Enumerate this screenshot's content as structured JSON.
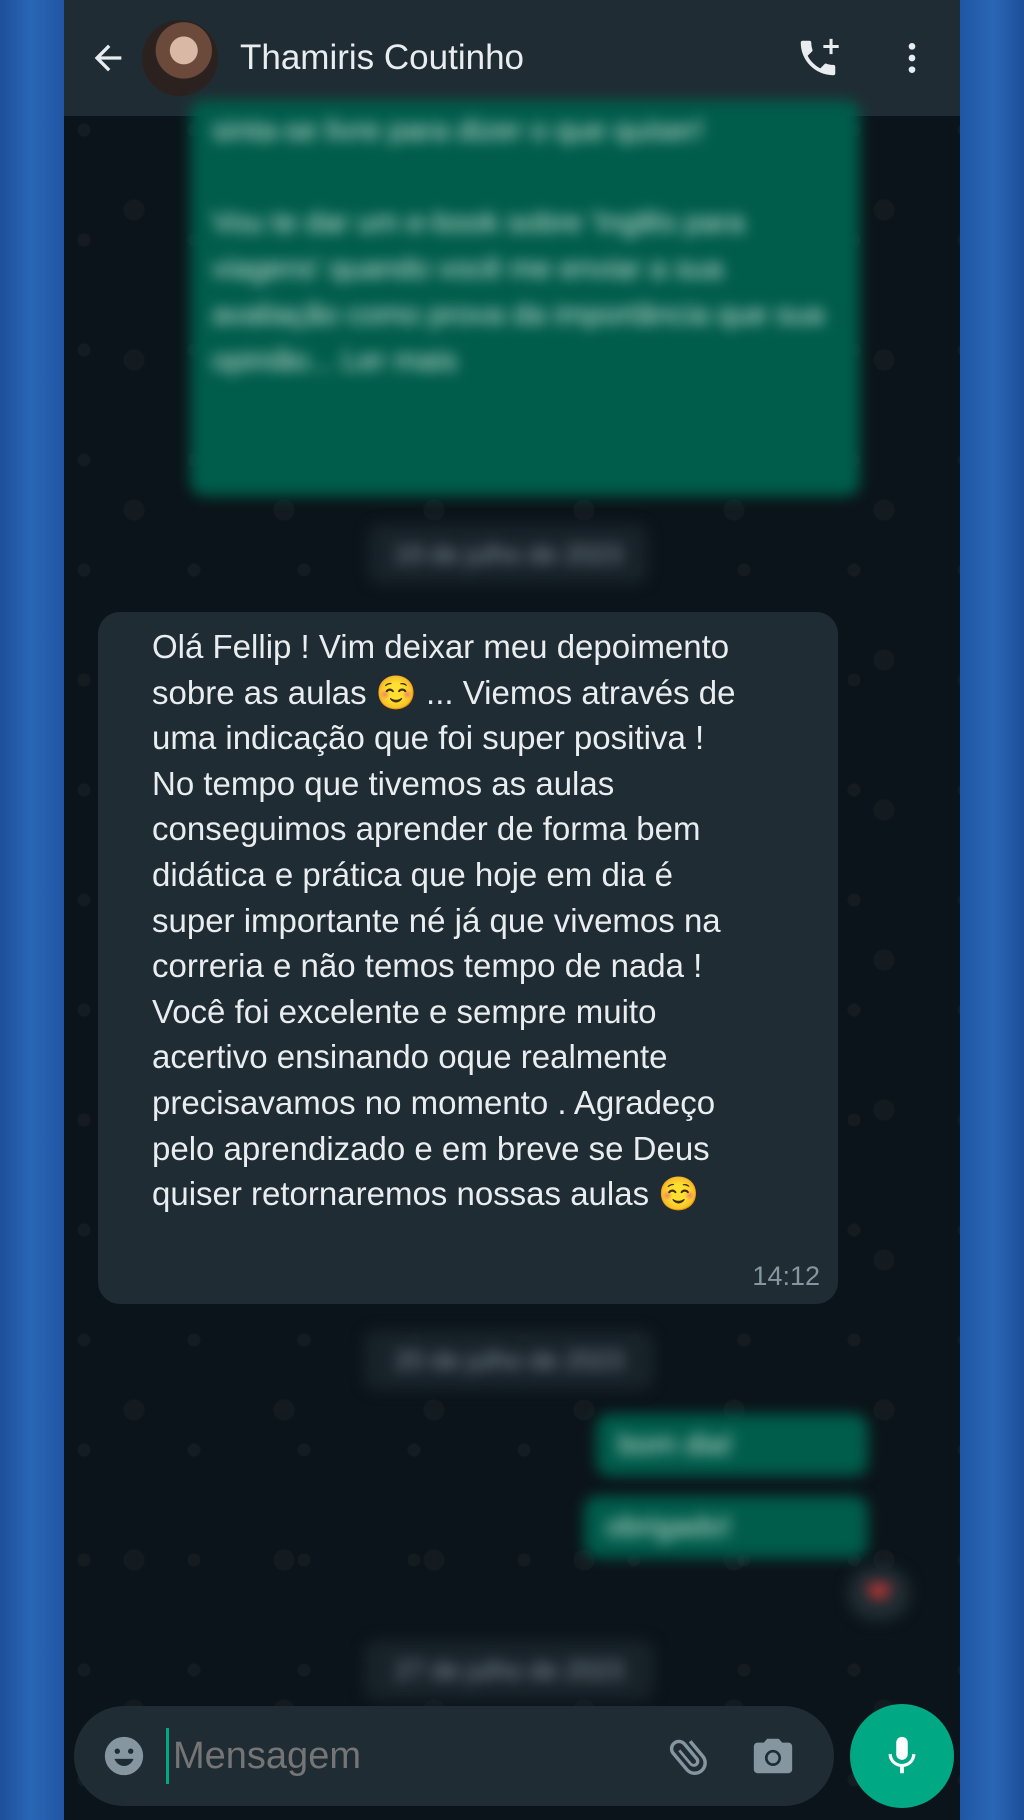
{
  "header": {
    "contact_name": "Thamiris Coutinho"
  },
  "blurred": {
    "top_message": "sinta-se livre para dizer o que quiser!\n\nVou te dar um e-book sobre 'Inglês para viagens' quando você me enviar a sua avaliação como prova da importância que sua opinião... Ler mais",
    "date_1": "19 de julho de 2023",
    "date_2": "20 de julho de 2023",
    "date_3": "27 de julho de 2023",
    "reply_1": "bom dia!",
    "reply_2": "obrigado!"
  },
  "message": {
    "text": "Olá Fellip ! Vim deixar meu depoimento\nsobre as aulas ☺️ ... Viemos através de\numa indicação que foi super positiva !\nNo tempo que tivemos as aulas\nconseguimos aprender de forma bem\ndidática e prática que hoje em dia é\nsuper importante né já que vivemos na\ncorreria e não temos tempo de nada !\nVocê foi excelente e sempre muito\nacertivo ensinando oque realmente\nprecisavamos no momento . Agradeço\npelo aprendizado e em breve se Deus\nquiser retornaremos nossas aulas ☺️",
    "time": "14:12"
  },
  "reaction": "❤",
  "composer": {
    "placeholder": "Mensagem"
  },
  "icons": {
    "back": "arrow-left-icon",
    "call": "add-call-icon",
    "menu": "more-vertical-icon",
    "emoji": "emoji-icon",
    "attach": "paperclip-icon",
    "camera": "camera-icon",
    "mic": "microphone-icon"
  },
  "colors": {
    "header_bg": "#1f2c34",
    "chat_bg": "#0b141a",
    "incoming_bubble": "#202c33",
    "outgoing_bubble": "#005c4b",
    "accent": "#00a884"
  }
}
